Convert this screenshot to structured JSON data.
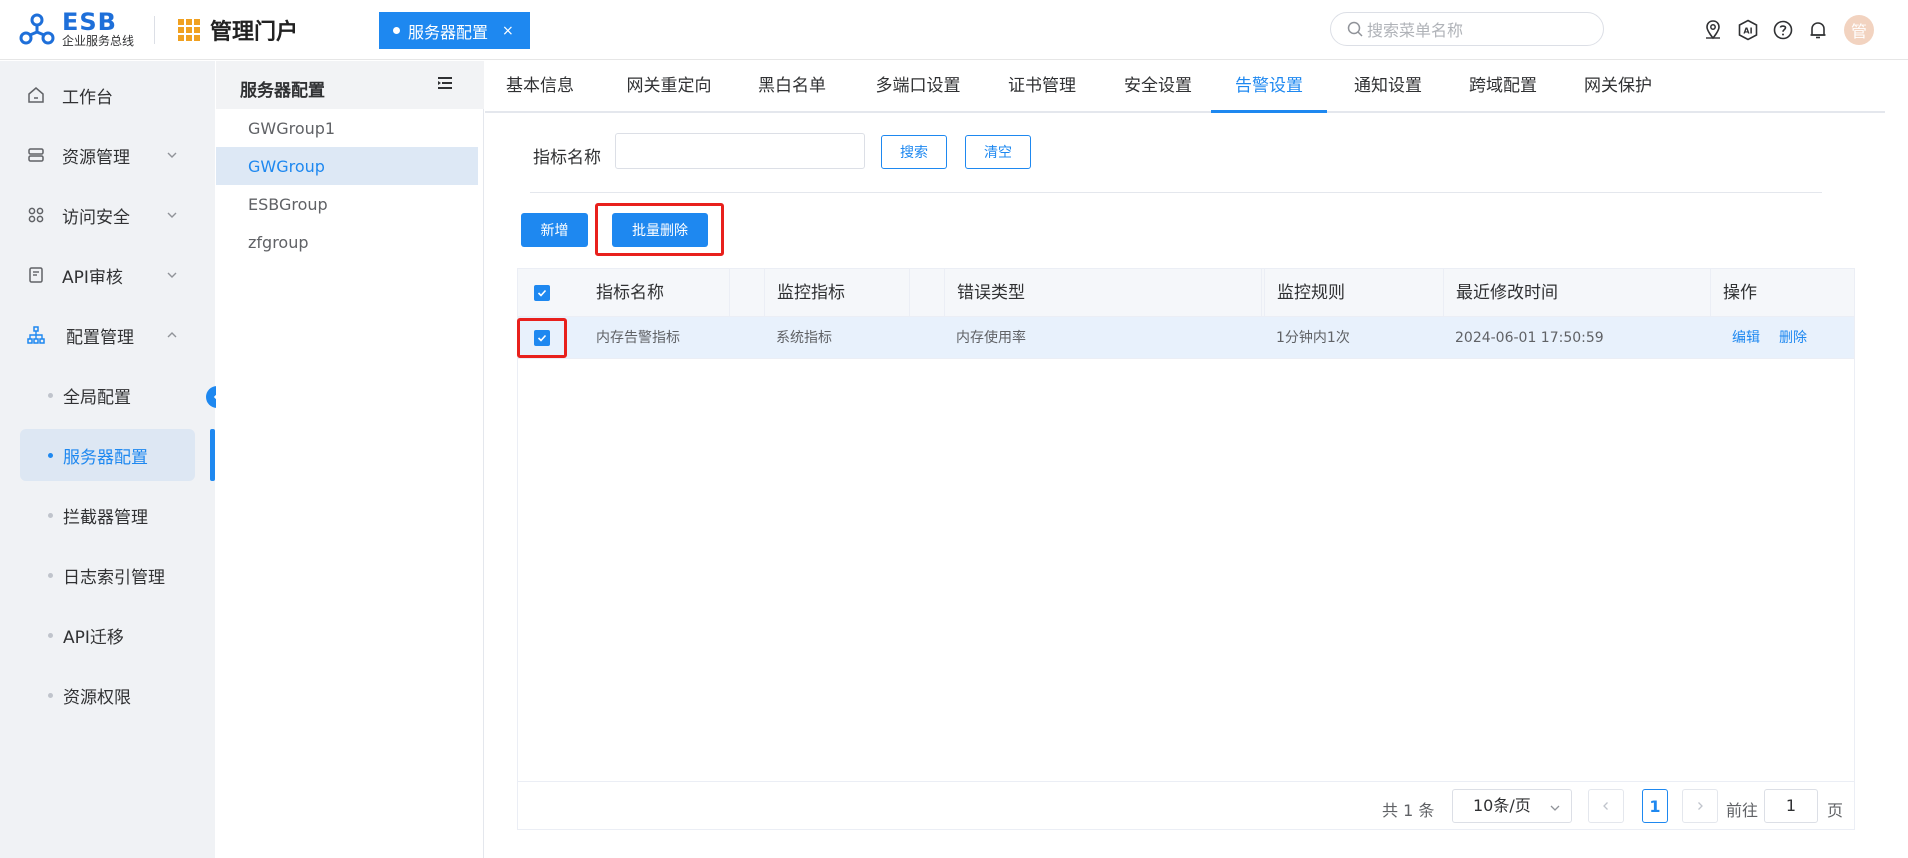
{
  "header": {
    "logo_main": "ESB",
    "logo_sub": "企业服务总线",
    "portal_title": "管理门户",
    "open_tab": "服务器配置",
    "open_tab_close": "×",
    "search_placeholder": "搜索菜单名称",
    "avatar_text": "管"
  },
  "sidebar": {
    "items": [
      {
        "label": "工作台",
        "icon": "home-icon"
      },
      {
        "label": "资源管理",
        "icon": "server-icon"
      },
      {
        "label": "访问安全",
        "icon": "apps-icon"
      },
      {
        "label": "API审核",
        "icon": "audit-icon"
      },
      {
        "label": "配置管理",
        "icon": "org-chart-icon"
      }
    ],
    "sub_items": [
      {
        "label": "全局配置"
      },
      {
        "label": "服务器配置"
      },
      {
        "label": "拦截器管理"
      },
      {
        "label": "日志索引管理"
      },
      {
        "label": "API迁移"
      },
      {
        "label": "资源权限"
      }
    ]
  },
  "group_panel": {
    "title": "服务器配置",
    "groups": [
      "GWGroup1",
      "GWGroup",
      "ESBGroup",
      "zfgroup"
    ]
  },
  "tabs": [
    "基本信息",
    "网关重定向",
    "黑白名单",
    "多端口设置",
    "证书管理",
    "安全设置",
    "告警设置",
    "通知设置",
    "跨域配置",
    "网关保护"
  ],
  "filter": {
    "label": "指标名称",
    "value": "",
    "search_btn": "搜索",
    "clear_btn": "清空"
  },
  "actions": {
    "add": "新增",
    "batch_delete": "批量删除"
  },
  "table": {
    "columns": [
      "指标名称",
      "监控指标",
      "错误类型",
      "监控规则",
      "最近修改时间",
      "操作"
    ],
    "rows": [
      {
        "name": "内存告警指标",
        "metric": "系统指标",
        "error_type": "内存使用率",
        "rule": "1分钟内1次",
        "modified": "2024-06-01 17:50:59",
        "edit": "编辑",
        "delete": "删除"
      }
    ]
  },
  "pagination": {
    "total": "共 1 条",
    "page_size": "10条/页",
    "current": "1",
    "goto_label": "前往",
    "goto_value": "1",
    "page_suffix": "页"
  },
  "colors": {
    "primary": "#1e88f0",
    "highlight": "#e8201c",
    "grid_icon": "#f0a020"
  }
}
